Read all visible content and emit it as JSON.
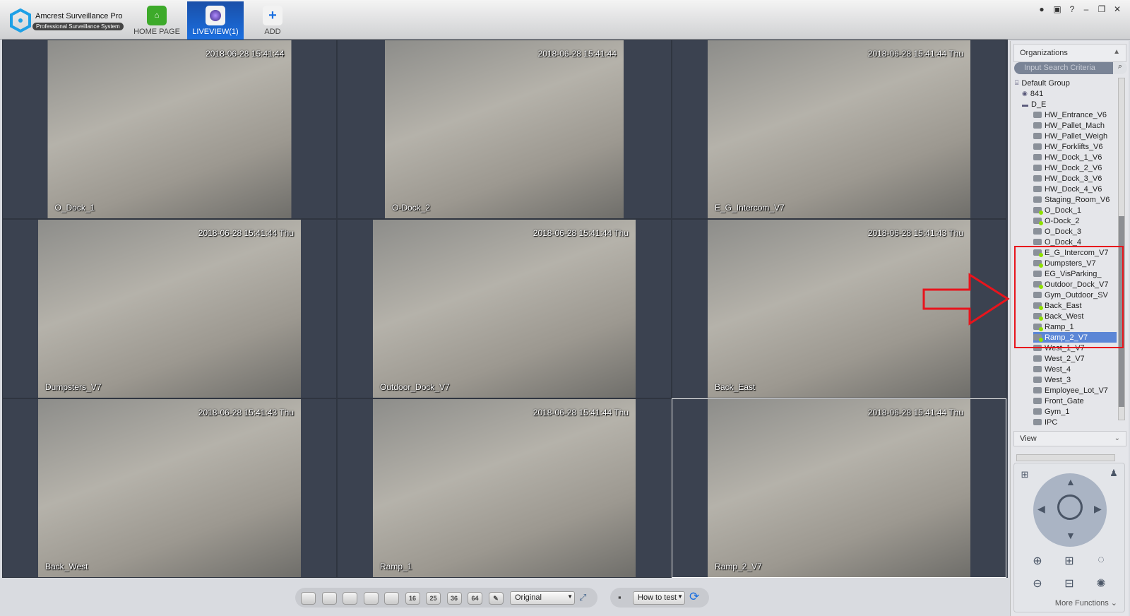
{
  "app": {
    "title": "Amcrest Surveillance Pro",
    "subtitle": "Professional Surveillance System"
  },
  "nav": [
    {
      "label": "HOME PAGE",
      "icon": "home-icon"
    },
    {
      "label": "LIVEVIEW(1)",
      "icon": "camera-icon",
      "active": true
    },
    {
      "label": "ADD",
      "icon": "plus-icon"
    }
  ],
  "window_controls": [
    "user-icon",
    "lock-icon",
    "help-icon",
    "minimize-icon",
    "restore-icon",
    "close-icon"
  ],
  "window_glyphs": {
    "help": "?",
    "minimize": "–",
    "restore": "❐",
    "close": "✕"
  },
  "feeds": [
    {
      "timestamp": "2018-06-28 15:41:44",
      "label": "O_Dock_1"
    },
    {
      "timestamp": "2018-06-28 15:41:44",
      "label": "O-Dock_2"
    },
    {
      "timestamp": "2018-06-28 15:41:44 Thu",
      "label": "E_G_Intercom_V7"
    },
    {
      "timestamp": "2018-06-28 15:41:44 Thu",
      "label": "Dumpsters_V7"
    },
    {
      "timestamp": "2018-06-28 15:41:44 Thu",
      "label": "Outdoor_Dock_V7"
    },
    {
      "timestamp": "2018-06-28 15:41:43 Thu",
      "label": "Back_East"
    },
    {
      "timestamp": "2018-06-28 15:41:43 Thu",
      "label": "Back_West"
    },
    {
      "timestamp": "2018-06-28 15:41:44 Thu",
      "label": "Ramp_1"
    },
    {
      "timestamp": "2018-06-28 15:41:44 Thu",
      "label": "Ramp_2_V7",
      "selected": true
    }
  ],
  "panel": {
    "organizations": "Organizations",
    "search_placeholder": "Input Search Criteria",
    "tree": [
      {
        "label": "Default Group",
        "level": 0
      },
      {
        "label": "841",
        "level": 1
      },
      {
        "label": "D_E",
        "level": 1
      },
      {
        "label": "HW_Entrance_V6",
        "level": 2,
        "online": false
      },
      {
        "label": "HW_Pallet_Mach",
        "level": 2,
        "online": false
      },
      {
        "label": "HW_Pallet_Weigh",
        "level": 2,
        "online": false
      },
      {
        "label": "HW_Forklifts_V6",
        "level": 2,
        "online": false
      },
      {
        "label": "HW_Dock_1_V6",
        "level": 2,
        "online": false
      },
      {
        "label": "HW_Dock_2_V6",
        "level": 2,
        "online": false
      },
      {
        "label": "HW_Dock_3_V6",
        "level": 2,
        "online": false
      },
      {
        "label": "HW_Dock_4_V6",
        "level": 2,
        "online": false
      },
      {
        "label": "Staging_Room_V6",
        "level": 2,
        "online": false
      },
      {
        "label": "O_Dock_1",
        "level": 2,
        "online": true
      },
      {
        "label": "O-Dock_2",
        "level": 2,
        "online": true
      },
      {
        "label": "O_Dock_3",
        "level": 2,
        "online": false
      },
      {
        "label": "O_Dock_4",
        "level": 2,
        "online": false
      },
      {
        "label": "E_G_Intercom_V7",
        "level": 2,
        "online": true
      },
      {
        "label": "Dumpsters_V7",
        "level": 2,
        "online": true
      },
      {
        "label": "EG_VisParking_",
        "level": 2,
        "online": false
      },
      {
        "label": "Outdoor_Dock_V7",
        "level": 2,
        "online": true
      },
      {
        "label": "Gym_Outdoor_SV",
        "level": 2,
        "online": false
      },
      {
        "label": "Back_East",
        "level": 2,
        "online": true
      },
      {
        "label": "Back_West",
        "level": 2,
        "online": true
      },
      {
        "label": "Ramp_1",
        "level": 2,
        "online": true
      },
      {
        "label": "Ramp_2_V7",
        "level": 2,
        "online": true,
        "selected": true
      },
      {
        "label": "West_1_V7",
        "level": 2,
        "online": false
      },
      {
        "label": "West_2_V7",
        "level": 2,
        "online": false
      },
      {
        "label": "West_4",
        "level": 2,
        "online": false
      },
      {
        "label": "West_3",
        "level": 2,
        "online": false
      },
      {
        "label": "Employee_Lot_V7",
        "level": 2,
        "online": false
      },
      {
        "label": "Front_Gate",
        "level": 2,
        "online": false
      },
      {
        "label": "Gym_1",
        "level": 2,
        "online": false
      },
      {
        "label": "IPC",
        "level": 2,
        "online": false
      }
    ],
    "view": "View",
    "more_functions": "More Functions",
    "highlight_color": "#e8141c"
  },
  "toolbar": {
    "layouts": [
      "1",
      "4",
      "6",
      "8",
      "9",
      "16",
      "25",
      "36",
      "64",
      "custom"
    ],
    "stream": "Original",
    "view_plan": "How to test"
  }
}
